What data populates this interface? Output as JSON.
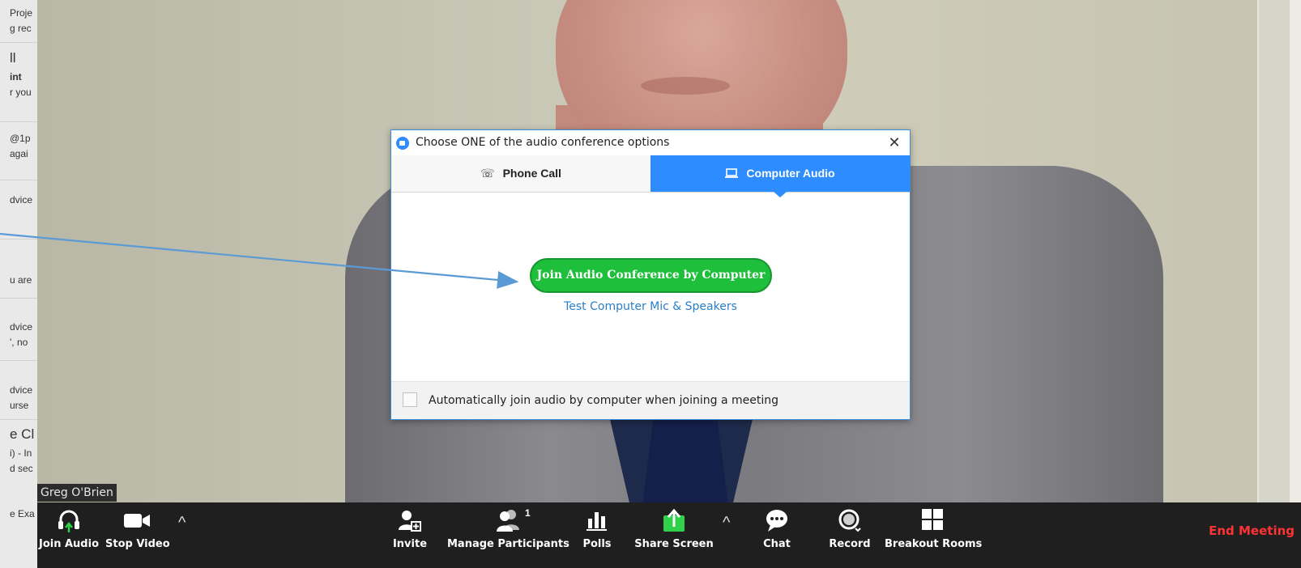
{
  "left_strip": {
    "fragments": [
      "Proje",
      "g rec",
      "ll",
      "int",
      "r you",
      "@1p",
      "agai",
      "dvice",
      "u are",
      "dvice",
      "', no",
      "dvice",
      "urse",
      "e Cl",
      "i) - In",
      "d sec",
      "e Exa"
    ]
  },
  "video": {
    "participant_name": "Greg O'Brien"
  },
  "dialog": {
    "title": "Choose ONE of the audio conference options",
    "close_glyph": "✕",
    "tabs": [
      {
        "label": "Phone Call",
        "icon": "phone-icon",
        "glyph": "☏",
        "active": false
      },
      {
        "label": "Computer Audio",
        "icon": "laptop-icon",
        "glyph": "💻",
        "active": true
      }
    ],
    "join_button": "Join Audio Conference by Computer",
    "test_link": "Test Computer Mic & Speakers",
    "auto_join_label": "Automatically join audio by computer when joining a meeting",
    "auto_join_checked": false
  },
  "toolbar": {
    "join_audio": "Join Audio",
    "stop_video": "Stop Video",
    "invite": "Invite",
    "manage_participants": "Manage Participants",
    "participant_count": "1",
    "polls": "Polls",
    "share_screen": "Share Screen",
    "chat": "Chat",
    "record": "Record",
    "breakout_rooms": "Breakout Rooms",
    "end_meeting": "End Meeting"
  },
  "colors": {
    "accent_blue": "#2d8cff",
    "join_green": "#1ebf3b",
    "end_red": "#ff3333",
    "toolbar_bg": "#1f1f1f",
    "share_green": "#2fd14a",
    "annotation_arrow": "#5b9bd5"
  }
}
